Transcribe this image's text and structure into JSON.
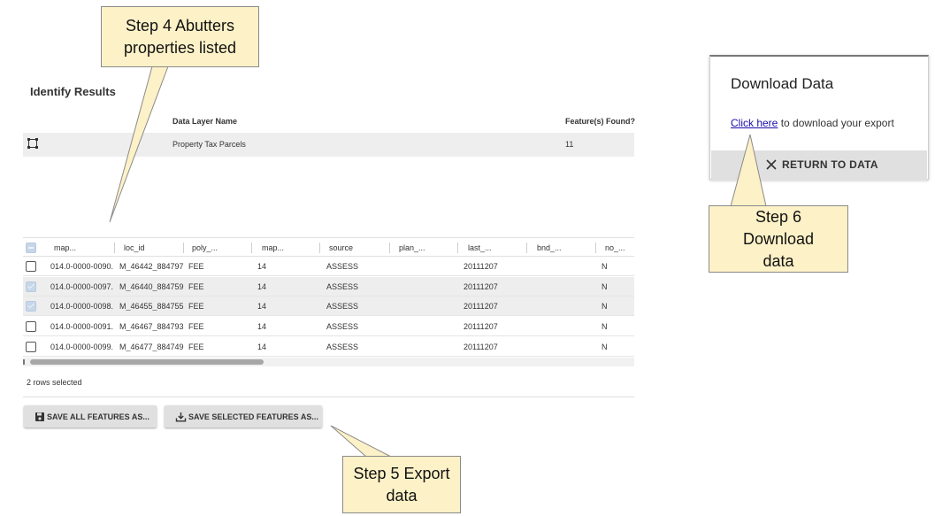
{
  "identify": {
    "title": "Identify Results",
    "col_layer": "Data Layer Name",
    "col_found": "Feature(s) Found?",
    "layer_name": "Property Tax Parcels",
    "found_count": "11"
  },
  "grid": {
    "headers": [
      "map...",
      "loc_id",
      "poly_...",
      "map...",
      "source",
      "plan_...",
      "last_...",
      "bnd_...",
      "no_..."
    ],
    "rows": [
      {
        "checked": false,
        "cells": [
          "014.0-0000-0090.",
          "M_46442_884797",
          "FEE",
          "14",
          "ASSESS",
          "",
          "20111207",
          "",
          "N"
        ]
      },
      {
        "checked": true,
        "cells": [
          "014.0-0000-0097.",
          "M_46440_884759",
          "FEE",
          "14",
          "ASSESS",
          "",
          "20111207",
          "",
          "N"
        ]
      },
      {
        "checked": true,
        "cells": [
          "014.0-0000-0098.",
          "M_46455_884755",
          "FEE",
          "14",
          "ASSESS",
          "",
          "20111207",
          "",
          "N"
        ]
      },
      {
        "checked": false,
        "cells": [
          "014.0-0000-0091.",
          "M_46467_884793",
          "FEE",
          "14",
          "ASSESS",
          "",
          "20111207",
          "",
          "N"
        ]
      },
      {
        "checked": false,
        "cells": [
          "014.0-0000-0099.",
          "M_46477_884749",
          "FEE",
          "14",
          "ASSESS",
          "",
          "20111207",
          "",
          "N"
        ]
      }
    ],
    "rows_selected": "2 rows selected"
  },
  "buttons": {
    "save_all": "SAVE ALL FEATURES AS...",
    "save_selected": "SAVE SELECTED FEATURES AS..."
  },
  "dialog": {
    "title": "Download Data",
    "link": "Click here",
    "body_rest": " to download your export",
    "return_label": "RETURN TO DATA"
  },
  "callouts": {
    "step4": "Step 4 Abutters properties listed",
    "step5": "Step 5 Export data",
    "step6": "Step 6 Download data"
  },
  "colors": {
    "callout_fill": "#fdf1c7",
    "selected_row": "#eeeeee",
    "checkbox_checked": "#c7d6e8",
    "link": "#1a0dab"
  }
}
